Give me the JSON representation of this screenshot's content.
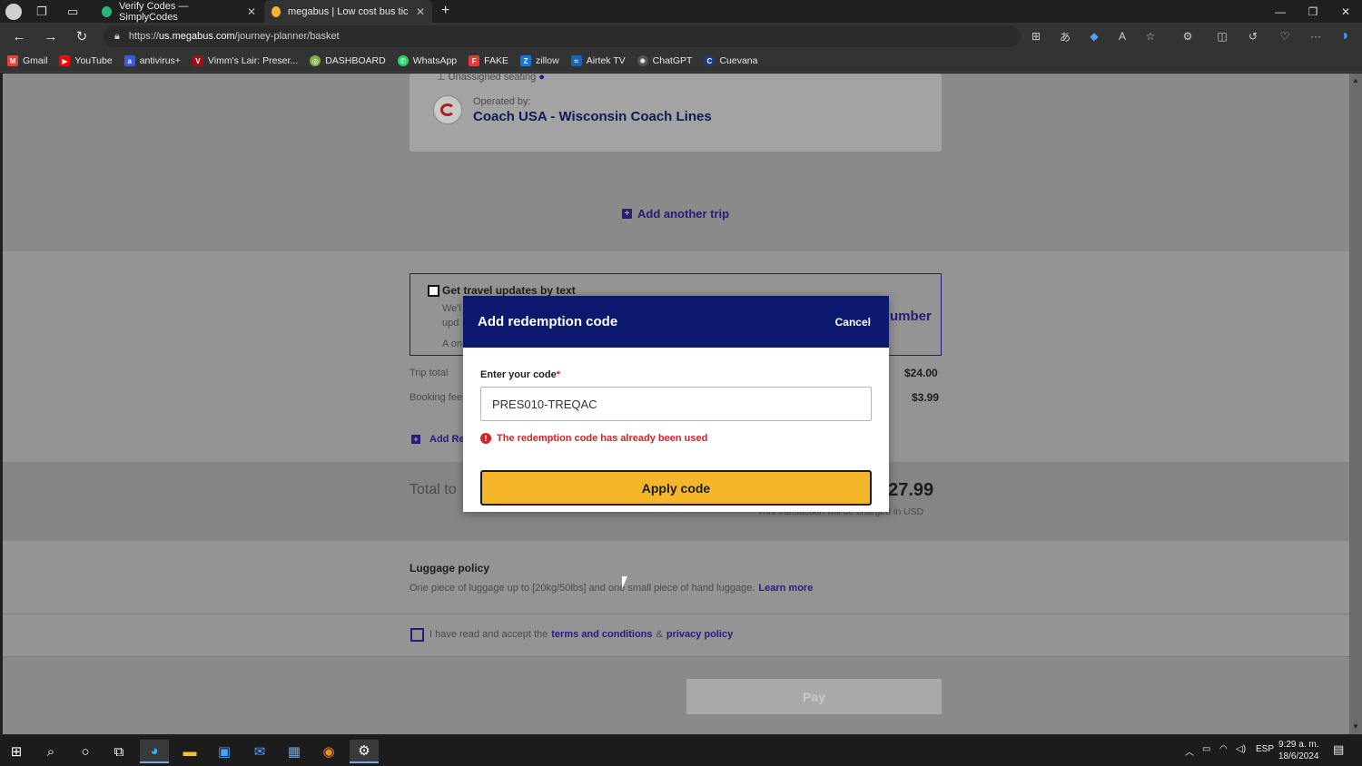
{
  "browser": {
    "tabs": [
      {
        "title": "Verify Codes — SimplyCodes",
        "active": false
      },
      {
        "title": "megabus | Low cost bus tickets f",
        "active": true
      }
    ],
    "url_prefix": "https://",
    "url_host": "us.megabus.com",
    "url_path": "/journey-planner/basket",
    "bookmarks": [
      "Gmail",
      "YouTube",
      "antivirus+",
      "Vimm's Lair: Preser...",
      "DASHBOARD",
      "WhatsApp",
      "FAKE",
      "zillow",
      "Airtek TV",
      "ChatGPT",
      "Cuevana"
    ]
  },
  "page": {
    "seating": "Unassigned seating",
    "operated_by_label": "Operated by:",
    "operator_name": "Coach USA - Wisconsin Coach Lines",
    "add_trip": "Add another trip",
    "sms_title": "Get travel updates by text",
    "sms_line1": "We'l",
    "sms_line2": "upd",
    "sms_line3": "A on",
    "sms_number_link": "umber",
    "trip_total_label": "Trip total",
    "trip_total_value": "$24.00",
    "booking_fee_label": "Booking fee",
    "booking_fee_value": "$3.99",
    "add_redemption": "Add Re",
    "total_label": "Total to",
    "total_value": "$27.99",
    "currency_note": "This transaction will be charged in USD",
    "luggage_title": "Luggage policy",
    "luggage_text": "One piece of luggage up to [20kg/50lbs] and one small piece of hand luggage.",
    "luggage_link": "Learn more",
    "terms_prefix": "I have read and accept the",
    "terms_link": "terms and conditions",
    "terms_amp": "&",
    "privacy_link": "privacy policy",
    "pay_label": "Pay"
  },
  "modal": {
    "title": "Add redemption code",
    "cancel": "Cancel",
    "code_label": "Enter your code",
    "required_mark": "*",
    "code_value": "PRES010-TREQAC",
    "error": "The redemption code has already been used",
    "apply_label": "Apply code"
  },
  "taskbar": {
    "language": "ESP",
    "time": "9:29 a. m.",
    "date": "18/6/2024"
  },
  "colors": {
    "modal_header": "#0b1a6e",
    "apply_button": "#f5b62a",
    "error": "#d2232a",
    "link": "#2a1a7a"
  }
}
